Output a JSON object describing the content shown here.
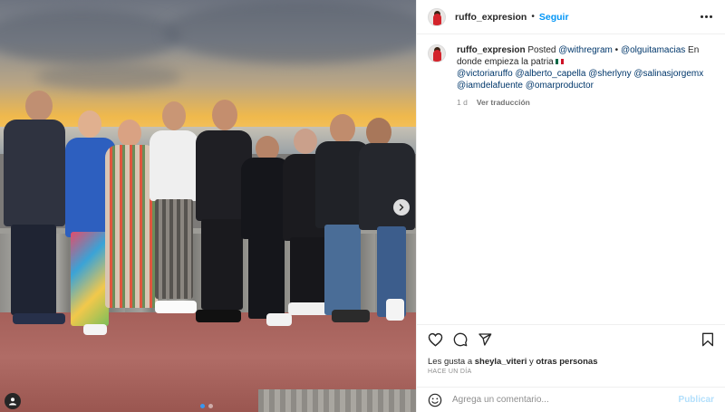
{
  "post": {
    "username": "ruffo_expresion",
    "separator": "•",
    "follow_label": "Seguir",
    "caption": {
      "username": "ruffo_expresion",
      "text_before": "Posted",
      "via": "@withregram",
      "dot": "•",
      "mention": "@olguitamacias",
      "text_after": "En donde empieza la patria",
      "tags": [
        "@victoriaruffo",
        "@alberto_capella",
        "@sherlyny",
        "@salinasjorgemx",
        "@iamdelafuente",
        "@omarproductor"
      ]
    },
    "age": "1 d",
    "translate_label": "Ver traducción",
    "likes_prefix": "Les gusta a",
    "likes_user": "sheyla_viteri",
    "likes_joiner": "y",
    "likes_others": "otras personas",
    "timestamp": "HACE UN DÍA",
    "comment_placeholder": "Agrega un comentario...",
    "publish_label": "Publicar"
  },
  "colors": {
    "accent": "#0095f6",
    "link": "#00376b",
    "publish_disabled": "#b2dffc",
    "muted": "#8e8e8e"
  },
  "icons": {
    "more": "more-options-icon",
    "like": "heart-icon",
    "comment": "comment-icon",
    "share": "share-icon",
    "save": "bookmark-icon",
    "emoji": "emoji-icon",
    "next": "chevron-right-icon",
    "tag": "user-tag-icon"
  },
  "carousel": {
    "count": 2,
    "active": 1
  }
}
